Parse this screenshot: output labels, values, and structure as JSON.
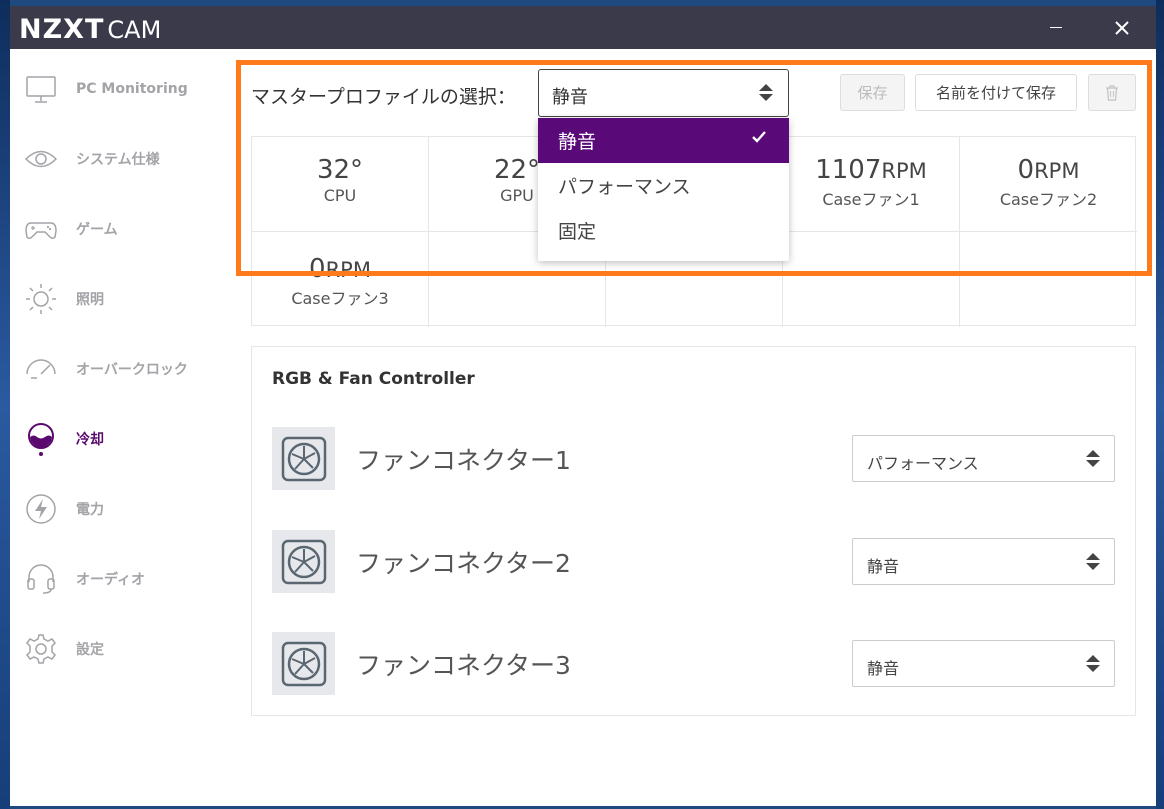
{
  "app": {
    "logo_bold": "NZXT",
    "logo_light": "CAM",
    "close_glyph": "✕"
  },
  "sidebar": {
    "items": [
      {
        "label": "PC Monitoring",
        "icon": "monitor-icon"
      },
      {
        "label": "システム仕様",
        "icon": "eye-icon"
      },
      {
        "label": "ゲーム",
        "icon": "gamepad-icon"
      },
      {
        "label": "照明",
        "icon": "sun-icon"
      },
      {
        "label": "オーバークロック",
        "icon": "gauge-icon"
      },
      {
        "label": "冷却",
        "icon": "cooling-icon",
        "active": true
      },
      {
        "label": "電力",
        "icon": "lightning-icon"
      },
      {
        "label": "オーディオ",
        "icon": "headset-icon"
      },
      {
        "label": "設定",
        "icon": "gear-icon"
      }
    ]
  },
  "profile": {
    "label": "マスタープロファイルの選択：",
    "selected": "静音",
    "options": [
      "静音",
      "パフォーマンス",
      "固定"
    ]
  },
  "toolbar": {
    "save": "保存",
    "save_as": "名前を付けて保存"
  },
  "stats": [
    {
      "value": "32°",
      "unit": "",
      "name": "CPU"
    },
    {
      "value": "22°",
      "unit": "",
      "name": "GPU"
    },
    {
      "value": "",
      "unit": "",
      "name": ""
    },
    {
      "value": "1107",
      "unit": "RPM",
      "name": "Caseファン1"
    },
    {
      "value": "0",
      "unit": "RPM",
      "name": "Caseファン2"
    },
    {
      "value": "0",
      "unit": "RPM",
      "name": "Caseファン3"
    }
  ],
  "controller": {
    "title": "RGB & Fan Controller",
    "fans": [
      {
        "label": "ファンコネクター1",
        "mode": "パフォーマンス"
      },
      {
        "label": "ファンコネクター2",
        "mode": "静音"
      },
      {
        "label": "ファンコネクター3",
        "mode": "静音"
      }
    ]
  },
  "colors": {
    "accent": "#5a0a78",
    "highlight": "#ff7a1a",
    "titlebar": "#3a3a4a"
  }
}
